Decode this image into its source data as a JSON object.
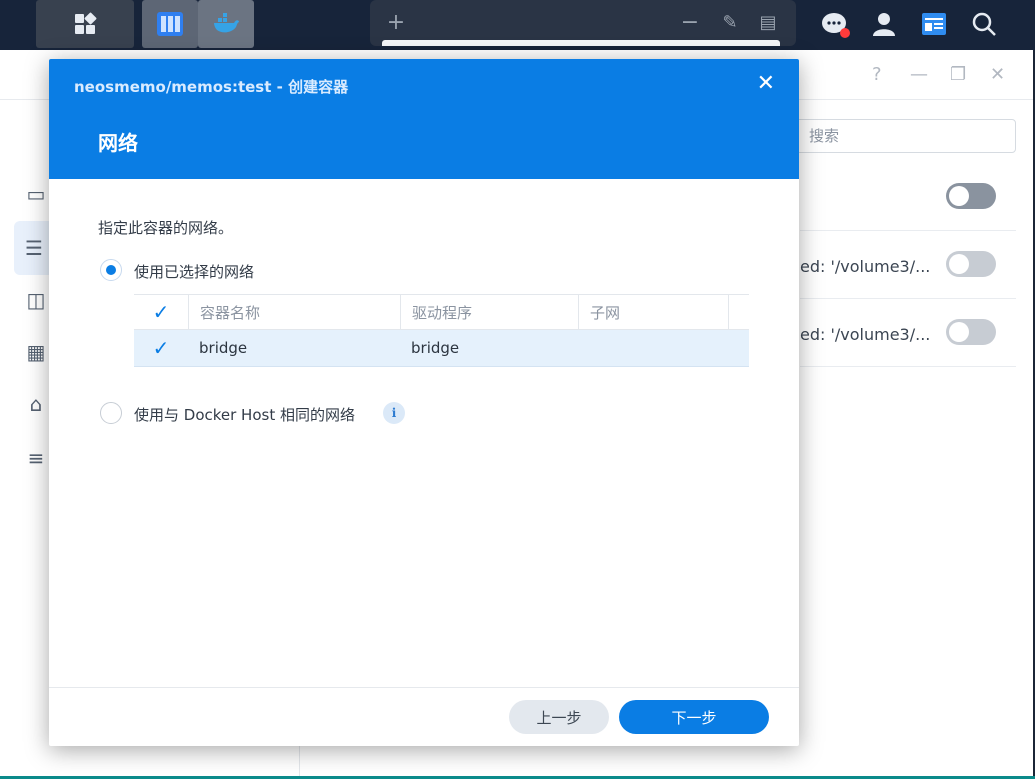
{
  "taskbar": {
    "icons": [
      "apps-grid-icon",
      "container-manager-app-icon",
      "docker-app-icon",
      "plus-icon",
      "minimize-icon",
      "pin-icon",
      "widget-icon",
      "chat-icon",
      "user-icon",
      "desktop-widget-icon",
      "search-icon"
    ]
  },
  "background_window": {
    "search_placeholder": "搜索",
    "rows": [
      {
        "text": "",
        "toggle_on": true
      },
      {
        "text": "ed: '/volume3/...",
        "toggle_on": false
      },
      {
        "text": "ed: '/volume3/...",
        "toggle_on": false
      }
    ],
    "controls": [
      "?",
      "—",
      "❐",
      "✕"
    ]
  },
  "dialog": {
    "title": "neosmemo/memos:test - 创建容器",
    "step": "网络",
    "description": "指定此容器的网络。",
    "option_selected_label": "使用已选择的网络",
    "option_host_label": "使用与 Docker Host 相同的网络",
    "table": {
      "headers": [
        "容器名称",
        "驱动程序",
        "子网"
      ],
      "rows": [
        {
          "name": "bridge",
          "driver": "bridge",
          "subnet": "",
          "checked": true
        }
      ]
    },
    "prev_button": "上一步",
    "next_button": "下一步"
  },
  "colors": {
    "accent": "#0a7de4",
    "toggle_on": "#8a939f",
    "toggle_off": "#c7ccd3"
  }
}
